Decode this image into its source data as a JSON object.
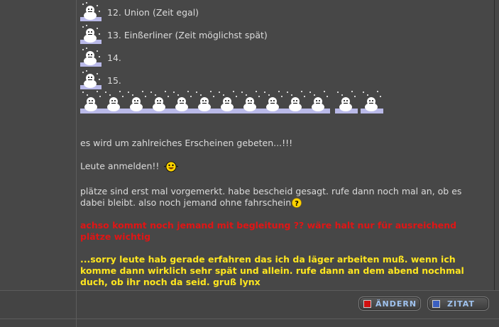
{
  "list": [
    {
      "label": "12. Union (Zeit egal)"
    },
    {
      "label": "13. Einßerliner (Zeit möglichst spät)"
    },
    {
      "label": "14."
    },
    {
      "label": "15."
    }
  ],
  "icons": {
    "list_icon": "snowman-icon",
    "strip_icon": "snowman-icon",
    "emoji_laugh": "laughing-smiley-icon",
    "emoji_question": "question-icon",
    "button_edit_icon": "red-square-icon",
    "button_quote_icon": "blue-square-icon"
  },
  "body": {
    "p1": "es wird um zahlreiches Erscheinen gebeten...!!!",
    "p2": "Leute anmelden!!",
    "p3": "plätze sind erst mal vorgemerkt. habe bescheid gesagt. rufe dann noch mal an, ob es dabei bleibt. also noch jemand ohne fahrschein",
    "p4_red": "achso kommt noch jemand mit begleitung ?? wäre halt nur für ausreichend plätze wichtig",
    "p5_yellow": "...sorry leute hab gerade erfahren das ich da läger arbeiten muß. wenn ich komme dann wirklich sehr spät und allein. rufe dann an dem abend nochmal duch, ob ihr noch da seid. gruß lynx"
  },
  "buttons": {
    "edit": "ÄNDERN",
    "quote": "ZITAT"
  },
  "colors": {
    "background": "#474747",
    "text": "#dcdcdc",
    "red_text": "#e01515",
    "yellow_text": "#ffe61f",
    "button_text": "#9fc2ee"
  }
}
